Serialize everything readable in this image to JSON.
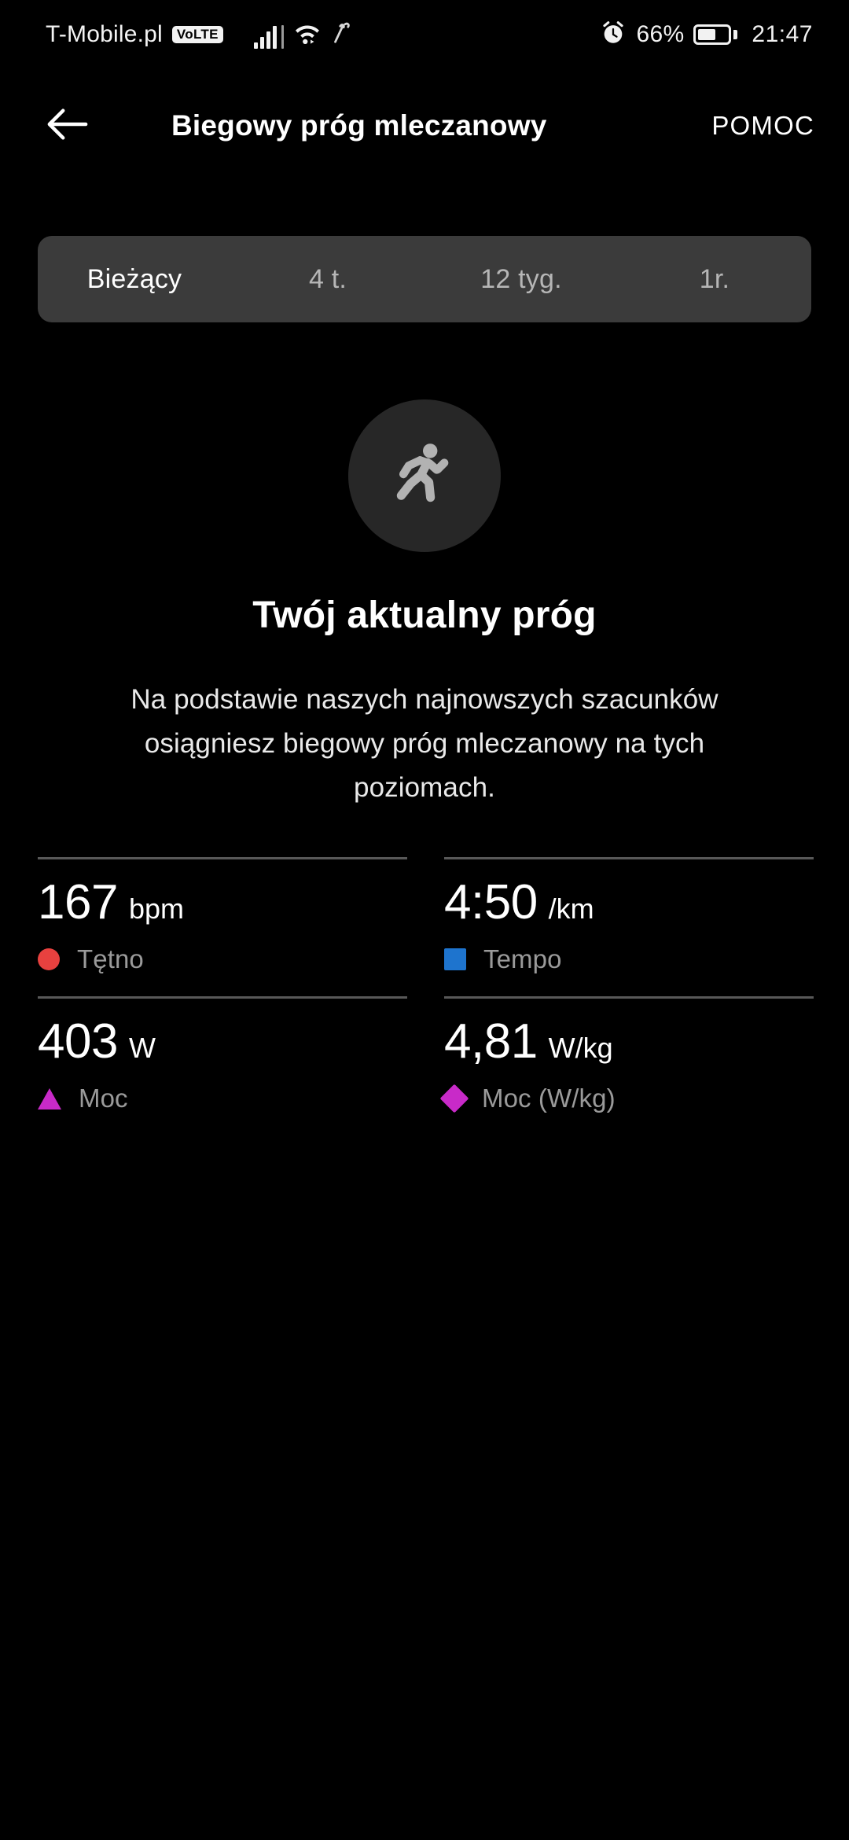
{
  "statusbar": {
    "carrier": "T-Mobile.pl",
    "volte_badge": "VoLTE",
    "signal_icon": "signal-bars-icon",
    "wifi_icon": "wifi-icon",
    "nfc_icon": "nfc-icon",
    "alarm_icon": "alarm-clock-icon",
    "battery_percent": "66%",
    "battery_icon": "battery-icon",
    "clock": "21:47"
  },
  "appbar": {
    "back_icon": "back-arrow-icon",
    "title": "Biegowy próg mleczanowy",
    "help_label": "POMOC"
  },
  "tabs": [
    {
      "label": "Bieżący",
      "active": true
    },
    {
      "label": "4 t.",
      "active": false
    },
    {
      "label": "12 tyg.",
      "active": false
    },
    {
      "label": "1r.",
      "active": false
    }
  ],
  "hero": {
    "icon": "running-person-icon",
    "title": "Twój aktualny próg",
    "description": "Na podstawie naszych najnowszych szacunków osiągniesz biegowy próg mleczanowy na tych poziomach."
  },
  "metrics": [
    {
      "value": "167",
      "unit": "bpm",
      "label": "Tętno",
      "marker": "circle",
      "color": "#e8413f"
    },
    {
      "value": "4:50",
      "unit": "/km",
      "label": "Tempo",
      "marker": "square",
      "color": "#1e74ce"
    },
    {
      "value": "403",
      "unit": "W",
      "label": "Moc",
      "marker": "triangle",
      "color": "#c82ac8"
    },
    {
      "value": "4,81",
      "unit": "W/kg",
      "label": "Moc (W/kg)",
      "marker": "diamond",
      "color": "#c82ac8"
    }
  ],
  "theme": {
    "background": "#000000",
    "tabbar_bg": "#3b3b3b",
    "hero_circle_bg": "#272727",
    "muted_text": "#9a9a9a",
    "divider": "#585858"
  }
}
